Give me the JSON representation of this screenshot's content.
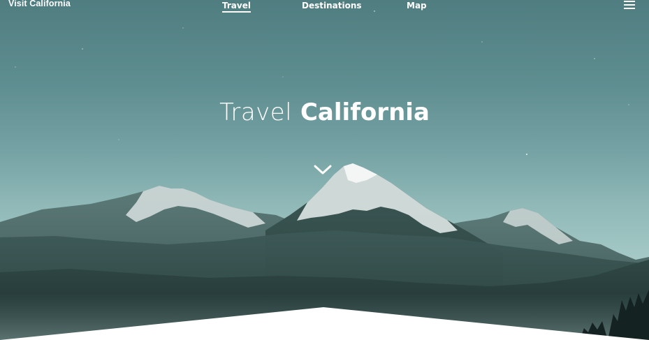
{
  "brand": {
    "name": "Visit California"
  },
  "nav": {
    "items": [
      {
        "label": "Travel",
        "active": true
      },
      {
        "label": "Destinations",
        "active": false
      },
      {
        "label": "Map",
        "active": false
      }
    ],
    "menu_icon": "hamburger-menu-icon"
  },
  "hero": {
    "title_light": "Travel",
    "title_bold": "California",
    "scroll_icon": "chevron-down-icon"
  },
  "colors": {
    "sky_top": "#4f7d80",
    "sky_bottom": "#c0dcd7",
    "text": "#ffffff",
    "mountain_dark": "#2a3f3d",
    "page_background": "#ffffff"
  }
}
